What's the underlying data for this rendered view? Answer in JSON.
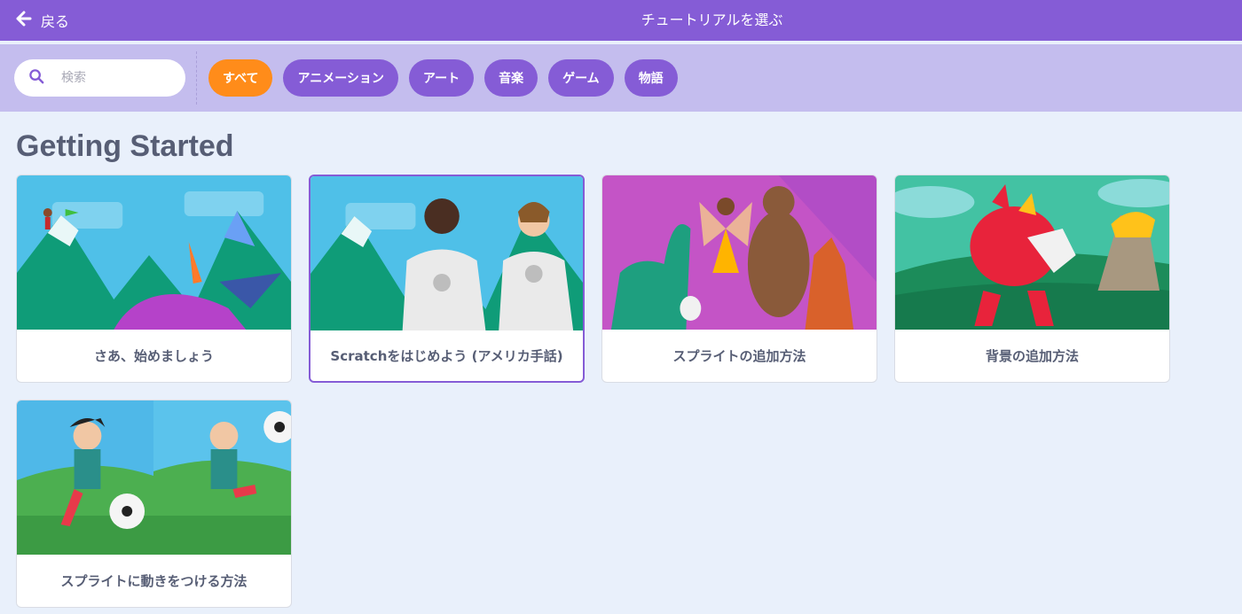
{
  "header": {
    "back_label": "戻る",
    "title": "チュートリアルを選ぶ"
  },
  "search": {
    "placeholder": "検索",
    "value": ""
  },
  "filters": [
    {
      "label": "すべて",
      "active": true
    },
    {
      "label": "アニメーション",
      "active": false
    },
    {
      "label": "アート",
      "active": false
    },
    {
      "label": "音楽",
      "active": false
    },
    {
      "label": "ゲーム",
      "active": false
    },
    {
      "label": "物語",
      "active": false
    }
  ],
  "section": {
    "title": "Getting Started"
  },
  "tutorials": [
    {
      "label": "さあ、始めましょう",
      "selected": false
    },
    {
      "label": "Scratchをはじめよう (アメリカ手話)",
      "selected": true
    },
    {
      "label": "スプライトの追加方法",
      "selected": false
    },
    {
      "label": "背景の追加方法",
      "selected": false
    },
    {
      "label": "スプライトに動きをつける方法",
      "selected": false
    }
  ],
  "colors": {
    "header_bg": "#855cd6",
    "filter_bar_bg": "#c4bdee",
    "chip_bg": "#855cd6",
    "chip_active_bg": "#ff8c1a",
    "page_bg": "#e9f0fb",
    "text": "#575e75"
  },
  "icons": {
    "back": "arrow-left-icon",
    "search": "search-icon"
  }
}
